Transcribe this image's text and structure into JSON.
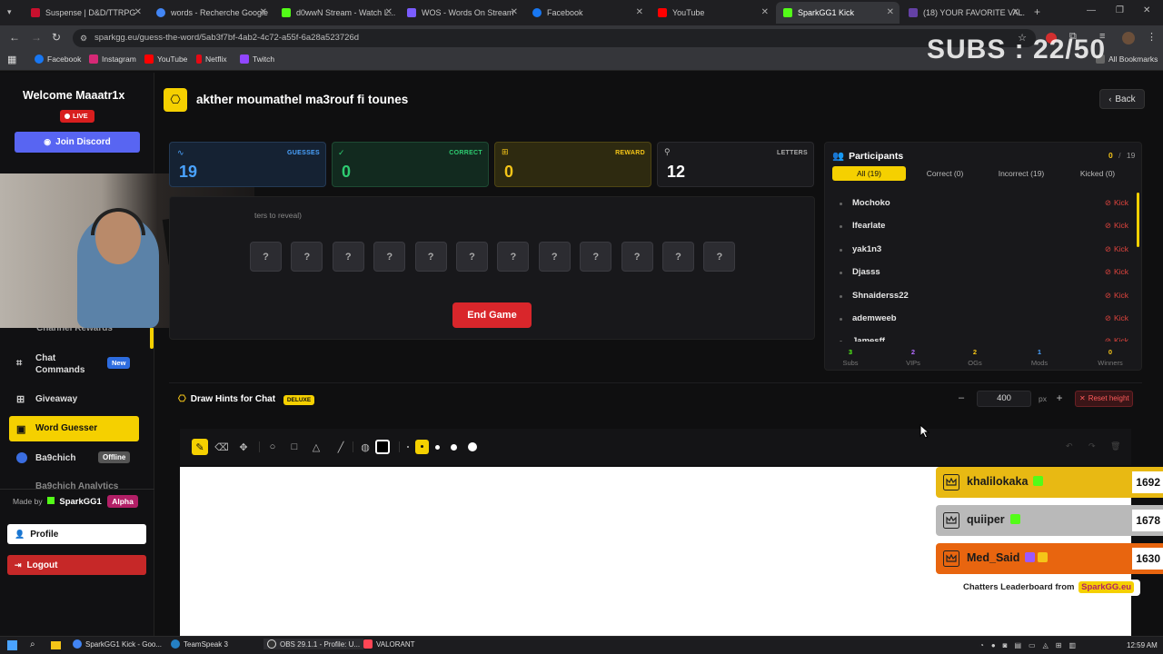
{
  "browser": {
    "tabs": [
      {
        "label": "Suspense | D&D/TTRPG",
        "color": "#c8102e"
      },
      {
        "label": "words - Recherche Google",
        "color": "#4285f4"
      },
      {
        "label": "d0wwN Stream - Watch L...",
        "color": "#53fc18"
      },
      {
        "label": "WOS - Words On Stream",
        "color": "#7a5cff"
      },
      {
        "label": "Facebook",
        "color": "#1877f2"
      },
      {
        "label": "YouTube",
        "color": "#ff0000"
      },
      {
        "label": "SparkGG1 Kick",
        "color": "#53fc18"
      },
      {
        "label": "(18) YOUR FAVORITE VAL...",
        "color": "#6441a5"
      }
    ],
    "url": "sparkgg.eu/guess-the-word/5ab3f7bf-4ab2-4c72-a55f-6a28a523726d",
    "bookmarks": [
      "Facebook",
      "Instagram",
      "YouTube",
      "Netflix",
      "Twitch"
    ],
    "all_bookmarks": "All Bookmarks",
    "subs_overlay": "SUBS : 22/50"
  },
  "sidebar": {
    "welcome": "Welcome",
    "username": "Maaatr1x",
    "live": "LIVE",
    "join_discord": "Join Discord",
    "items": {
      "channel_rewards": "Channel Rewards",
      "chat_commands": "Chat Commands",
      "chat_commands_badge": "New",
      "giveaway": "Giveaway",
      "word_guesser": "Word Guesser",
      "ba9chich": "Ba9chich",
      "ba9chich_badge": "Offline",
      "ba9chich_analytics": "Ba9chich Analytics"
    },
    "made_by": "Made by",
    "made_by_name": "SparkGG1",
    "alpha": "Alpha",
    "profile": "Profile",
    "logout": "Logout"
  },
  "game": {
    "title": "akther moumathel ma3rouf fi tounes",
    "back": "Back",
    "stats": {
      "guesses_label": "GUESSES",
      "guesses": "19",
      "correct_label": "CORRECT",
      "correct": "0",
      "reward_label": "REWARD",
      "reward": "0",
      "letters_label": "LETTERS",
      "letters": "12"
    },
    "hint": "ters to reveal)",
    "hidden_letters": [
      "?",
      "?",
      "?",
      "?",
      "?",
      "?",
      "?",
      "?",
      "?",
      "?",
      "?",
      "?"
    ],
    "end_game": "End Game"
  },
  "participants": {
    "title": "Participants",
    "count_current": "0",
    "count_sep": "/",
    "count_total": "19",
    "filters": [
      "All (19)",
      "Correct (0)",
      "Incorrect (19)",
      "Kicked (0)"
    ],
    "list": [
      "Mochoko",
      "Ifearlate",
      "yak1n3",
      "Djasss",
      "Shnaiderss22",
      "ademweeb",
      "Jamesff"
    ],
    "kick_label": "Kick",
    "summary": [
      {
        "n": "3",
        "t": "Subs",
        "color": "#53fc18"
      },
      {
        "n": "2",
        "t": "VIPs",
        "color": "#b36bff"
      },
      {
        "n": "2",
        "t": "OGs",
        "color": "#f5c518"
      },
      {
        "n": "1",
        "t": "Mods",
        "color": "#4aa3ff"
      },
      {
        "n": "0",
        "t": "Winners",
        "color": "#f5c518"
      }
    ]
  },
  "draw": {
    "title": "Draw Hints for Chat",
    "badge": "DELUXE",
    "height_value": "400",
    "px": "px",
    "reset": "Reset height"
  },
  "leaderboard": {
    "entries": [
      {
        "name": "khalilokaka",
        "score": "1692",
        "color": "#e8b913"
      },
      {
        "name": "quiiper",
        "score": "1678",
        "color": "#b9b9b9"
      },
      {
        "name": "Med_Said",
        "score": "1630",
        "color": "#e8650f"
      }
    ],
    "footer": "Chatters Leaderboard from",
    "footer_brand": "SparkGG.eu"
  },
  "taskbar": {
    "items": [
      "SparkGG1 Kick - Goo...",
      "TeamSpeak 3",
      "OBS 29.1.1 - Profile: U...",
      "VALORANT"
    ],
    "time": "12:59 AM"
  },
  "colors": {
    "accent_yellow": "#f5d000",
    "discord": "#5865f2",
    "danger": "#e53935",
    "kick_green": "#53fc18"
  }
}
